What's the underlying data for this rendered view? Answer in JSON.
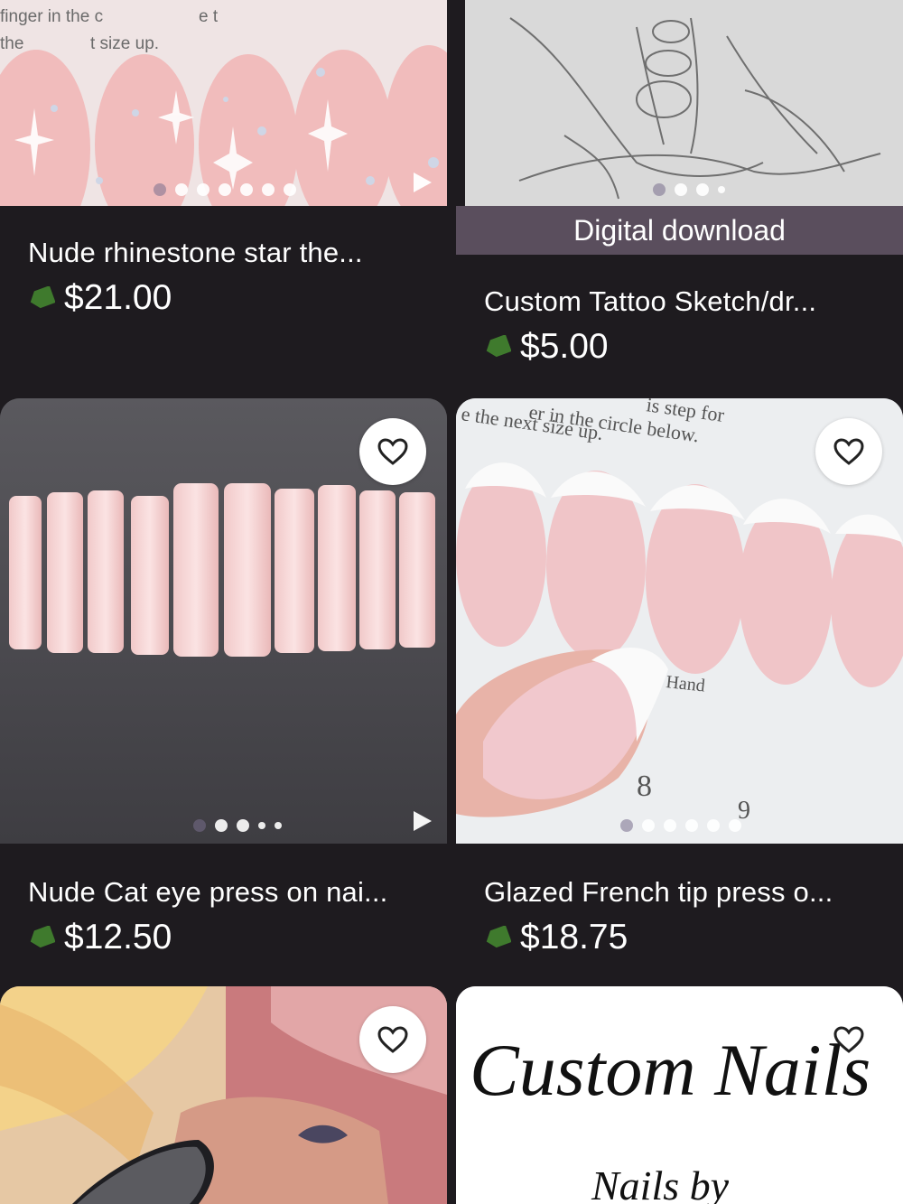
{
  "listings": [
    {
      "title": "Nude rhinestone star the...",
      "price": "$21.00",
      "image_text": [
        "finger in the c",
        "e t",
        "the",
        "t size up."
      ]
    },
    {
      "title": "Custom Tattoo Sketch/dr...",
      "price": "$5.00",
      "badge": "Digital download"
    },
    {
      "title": "Nude Cat eye press on nai...",
      "price": "$12.50"
    },
    {
      "title": "Glazed French tip press o...",
      "price": "$18.75",
      "image_text": [
        "is step for",
        "er in the circle below.",
        "e the next size up.",
        "Hand",
        "8",
        "9"
      ]
    },
    {
      "title": "",
      "price": ""
    },
    {
      "title": "",
      "price": "",
      "image_text": [
        "Custom Nails",
        "Nails by"
      ]
    }
  ],
  "icons": {
    "favorite": "heart-icon",
    "tag": "price-tag-icon",
    "video": "play-icon"
  },
  "colors": {
    "background": "#1e1b1f",
    "tag_green": "#3f7a2d",
    "badge_bg": "#5a4e5d"
  }
}
